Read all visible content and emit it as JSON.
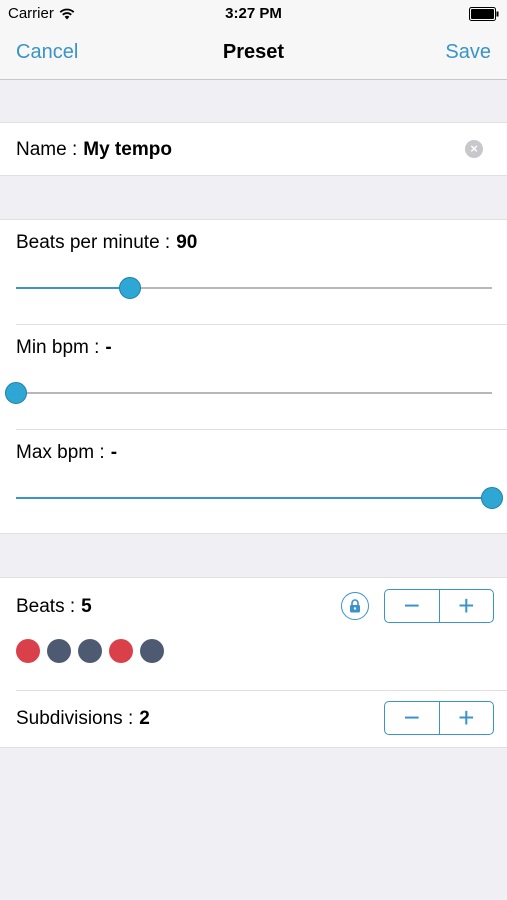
{
  "status": {
    "carrier": "Carrier",
    "time": "3:27 PM"
  },
  "nav": {
    "cancel": "Cancel",
    "title": "Preset",
    "save": "Save"
  },
  "name": {
    "label": "Name :",
    "value": "My tempo"
  },
  "bpm": {
    "label": "Beats per minute :",
    "value": "90",
    "slider_level": 0.24
  },
  "min_bpm": {
    "label": "Min bpm :",
    "value": "-",
    "slider_level": 0.0
  },
  "max_bpm": {
    "label": "Max bpm :",
    "value": "-",
    "slider_level": 1.0
  },
  "beats": {
    "label": "Beats :",
    "value": "5",
    "minus": "−",
    "plus": "+",
    "dots": [
      "accent",
      "normal",
      "normal",
      "accent",
      "normal"
    ],
    "colors": {
      "accent": "#d9404a",
      "normal": "#4e5a71"
    }
  },
  "subdivisions": {
    "label": "Subdivisions :",
    "value": "2",
    "minus": "−",
    "plus": "+"
  },
  "colors": {
    "accent": "#3a93c9",
    "background": "#efeff4"
  }
}
